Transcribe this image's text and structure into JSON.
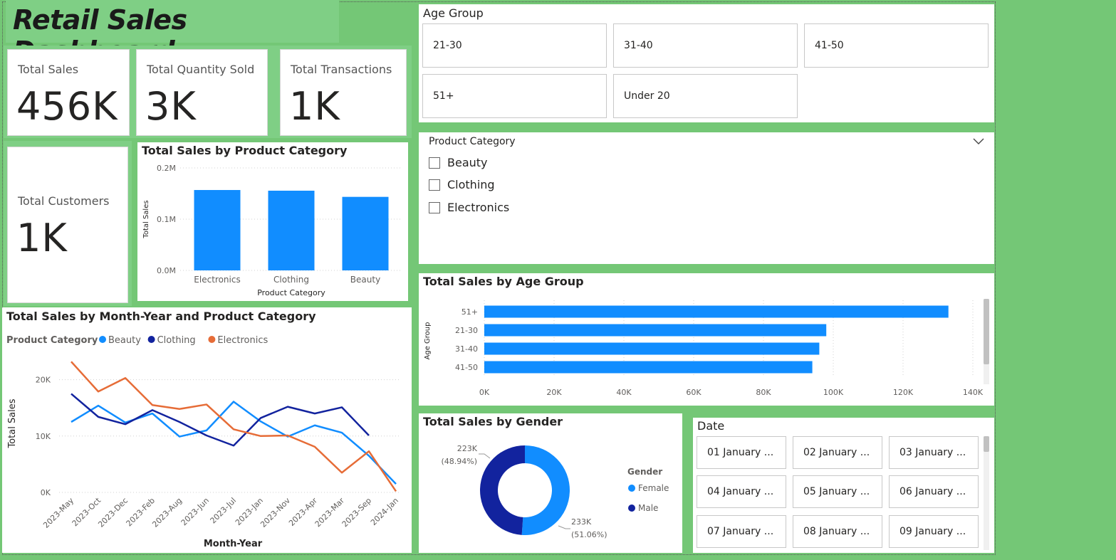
{
  "dashboard": {
    "title": "Retail Sales Dashboard"
  },
  "kpis": {
    "total_sales": {
      "label": "Total Sales",
      "value": "456K"
    },
    "total_quantity": {
      "label": "Total Quantity Sold",
      "value": "3K"
    },
    "total_transactions": {
      "label": "Total Transactions",
      "value": "1K"
    },
    "total_customers": {
      "label": "Total Customers",
      "value": "1K"
    }
  },
  "age_slicer": {
    "title": "Age Group",
    "options": [
      "21-30",
      "31-40",
      "41-50",
      "51+",
      "Under 20"
    ]
  },
  "category_slicer": {
    "title": "Product Category",
    "options": [
      "Beauty",
      "Clothing",
      "Electronics"
    ]
  },
  "date_slicer": {
    "title": "Date",
    "options": [
      "01 January ...",
      "02 January ...",
      "03 January ...",
      "04 January ...",
      "05 January ...",
      "06 January ...",
      "07 January ...",
      "08 January ...",
      "09 January ..."
    ]
  },
  "colors": {
    "beauty": "#118dff",
    "clothing": "#12239e",
    "electronics": "#e66c37",
    "female": "#118dff",
    "male": "#12239e",
    "bar": "#118dff"
  },
  "chart_data": [
    {
      "type": "bar",
      "title": "Total Sales by Product Category",
      "categories": [
        "Electronics",
        "Clothing",
        "Beauty"
      ],
      "values": [
        156905,
        155580,
        143515
      ],
      "xlabel": "Product Category",
      "ylabel": "Total Sales",
      "ylim": [
        0,
        200000
      ],
      "yticks": [
        "0.0M",
        "0.1M",
        "0.2M"
      ]
    },
    {
      "type": "bar",
      "orientation": "horizontal",
      "title": "Total Sales by Age Group",
      "categories": [
        "51+",
        "21-30",
        "31-40",
        "41-50"
      ],
      "values": [
        133000,
        98000,
        96000,
        94000
      ],
      "ylabel": "Age Group",
      "xlim": [
        0,
        140000
      ],
      "xticks": [
        "0K",
        "20K",
        "40K",
        "60K",
        "80K",
        "100K",
        "120K",
        "140K"
      ]
    },
    {
      "type": "line",
      "title": "Total Sales by Month-Year and Product Category",
      "legend_title": "Product Category",
      "categories": [
        "2023-May",
        "2023-Oct",
        "2023-Dec",
        "2023-Feb",
        "2023-Aug",
        "2023-Jun",
        "2023-Jul",
        "2023-Jan",
        "2023-Nov",
        "2023-Apr",
        "2023-Mar",
        "2023-Sep",
        "2024-Jan"
      ],
      "series": [
        {
          "name": "Beauty",
          "values": [
            12500,
            15400,
            12400,
            14000,
            9900,
            11000,
            16100,
            12600,
            9900,
            11900,
            10600,
            6500,
            1500
          ]
        },
        {
          "name": "Clothing",
          "values": [
            17500,
            13400,
            12100,
            14600,
            12500,
            10100,
            8300,
            13200,
            15200,
            14000,
            15100,
            10100,
            null
          ]
        },
        {
          "name": "Electronics",
          "values": [
            23200,
            17900,
            20300,
            15500,
            14800,
            15600,
            11200,
            10000,
            10100,
            8100,
            3500,
            7300,
            200
          ]
        }
      ],
      "xlabel": "Month-Year",
      "ylabel": "Total Sales",
      "ylim": [
        0,
        25000
      ],
      "yticks": [
        "0K",
        "10K",
        "20K"
      ]
    },
    {
      "type": "pie",
      "variant": "donut",
      "title": "Total Sales by Gender",
      "legend_title": "Gender",
      "categories": [
        "Female",
        "Male"
      ],
      "values": [
        233000,
        223000
      ],
      "data_labels": [
        "233K",
        "223K"
      ],
      "percent_labels": [
        "(51.06%)",
        "(48.94%)"
      ]
    }
  ]
}
